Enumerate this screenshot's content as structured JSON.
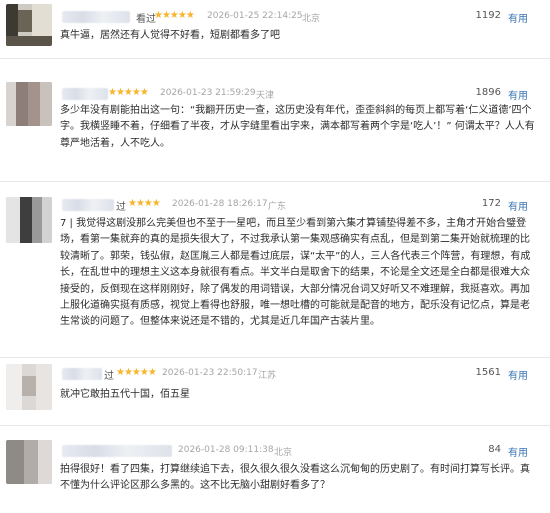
{
  "useful_label": "有用",
  "reviews": [
    {
      "user": "看过",
      "stars": "★★★★★",
      "datetime": "2026-01-25 22:14:25",
      "location": "北京",
      "count": "1192",
      "text": "真牛逼，居然还有人觉得不好看，短剧都看多了吧"
    },
    {
      "user": "",
      "stars": "★★★★★",
      "datetime": "2026-01-23 21:59:29",
      "location": "天津",
      "count": "1896",
      "text": "多少年没有剧能拍出这一句：“我翻开历史一查，这历史没有年代，歪歪斜斜的每页上都写着‘仁义道德’四个字。我横竖睡不着，仔细看了半夜，才从字缝里看出字来，满本都写着两个字是‘吃人’！” 何谓太平？人人有尊严地活着，人不吃人。"
    },
    {
      "user": "过",
      "stars": "★★★★",
      "datetime": "2026-01-28 18:26:17",
      "location": "广东",
      "count": "172",
      "text": "7 | 我觉得这剧没那么完美但也不至于一星吧，而且至少看到第六集才算铺垫得差不多，主角才开始合璧登场，看第一集就弃的真的是损失很大了，不过我承认第一集观感确实有点乱，但是到第二集开始就梳理的比较清晰了。郭荣，钱弘俶，赵匡胤三人都是看过底层，谋“太平”的人，三人各代表三个阵营，有理想，有成长，在乱世中的理想主义这本身就很有看点。半文半白是取舍下的结果，不论是全文还是全白都是很难大众接受的，反倒现在这样刚刚好，除了偶发的用词错误，大部分情况台词又好听又不难理解，我挺喜欢。再加上服化道确实挺有质感，视觉上看得也舒服，唯一想吐槽的可能就是配音的地方，配乐没有记忆点，算是老生常谈的问题了。但整体来说还是不错的，尤其是近几年国产古装片里。"
    },
    {
      "user": "过",
      "stars": "★★★★★",
      "datetime": "2026-01-23 22:50:17",
      "location": "江苏",
      "count": "1561",
      "text": "就冲它敢拍五代十国，佰五星"
    },
    {
      "user": "",
      "stars": "",
      "datetime": "2026-01-28 09:11:38",
      "location": "北京",
      "count": "84",
      "text": "拍得很好！看了四集，打算继续追下去，很久很久很久没看这么沉甸甸的历史剧了。有时间打算写长评。真不懂为什么评论区那么多黑的。这不比无脑小甜剧好看多了？"
    }
  ]
}
